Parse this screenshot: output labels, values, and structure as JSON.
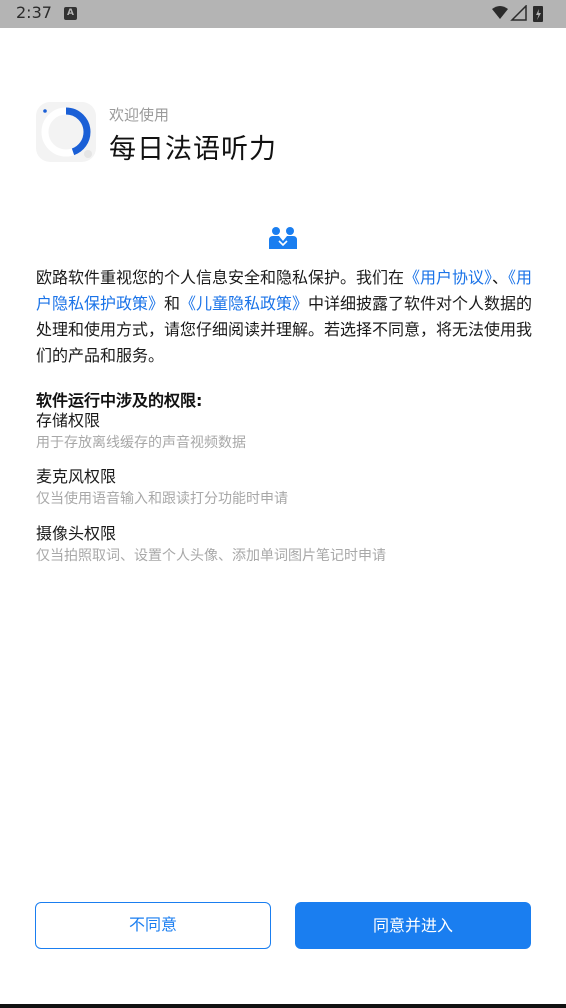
{
  "status_bar": {
    "time": "2:37",
    "notification_badge": "A",
    "icons": [
      "wifi-icon",
      "signal-icon",
      "battery-icon"
    ]
  },
  "header": {
    "welcome": "欢迎使用",
    "app_name": "每日法语听力"
  },
  "intro": {
    "part1": "欧路软件重视您的个人信息安全和隐私保护。我们在",
    "link1": "《用户协议》",
    "part2": "、",
    "link2": "《用户隐私保护政策》",
    "part3": "和",
    "link3": "《儿童隐私政策》",
    "part4": "中详细披露了软件对个人数据的处理和使用方式，请您仔细阅读并理解。若选择不同意，将无法使用我们的产品和服务。"
  },
  "permissions": {
    "title": "软件运行中涉及的权限:",
    "items": [
      {
        "name": "存储权限",
        "desc": "用于存放离线缓存的声音视频数据"
      },
      {
        "name": "麦克风权限",
        "desc": "仅当使用语音输入和跟读打分功能时申请"
      },
      {
        "name": "摄像头权限",
        "desc": "仅当拍照取词、设置个人头像、添加单词图片笔记时申请"
      }
    ]
  },
  "buttons": {
    "disagree": "不同意",
    "agree": "同意并进入"
  },
  "colors": {
    "accent": "#1a7ef0",
    "link": "#1a73e8",
    "status_bar": "#b4b4b4"
  }
}
